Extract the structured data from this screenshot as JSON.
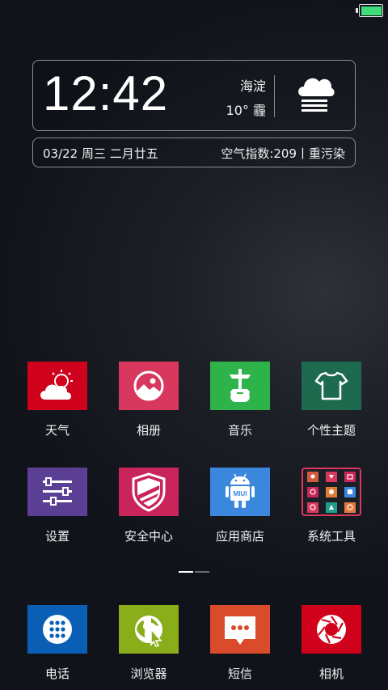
{
  "status": {
    "battery_level": 1.0,
    "battery_color": "#3fdc7a"
  },
  "clock_widget": {
    "time": "12:42",
    "location": "海淀",
    "temperature": "10° 霾",
    "weather_icon": "fog-cloud-icon"
  },
  "info_widget": {
    "date": "03/22 周三 二月廿五",
    "air_quality": "空气指数:209丨重污染"
  },
  "apps": [
    {
      "label": "天气",
      "icon": "weather-icon",
      "color": "#d0021b"
    },
    {
      "label": "相册",
      "icon": "gallery-icon",
      "color": "#d9385e"
    },
    {
      "label": "音乐",
      "icon": "music-icon",
      "color": "#2db34a"
    },
    {
      "label": "个性主题",
      "icon": "theme-icon",
      "color": "#1e6a4f"
    },
    {
      "label": "设置",
      "icon": "settings-icon",
      "color": "#5b3f94"
    },
    {
      "label": "安全中心",
      "icon": "security-icon",
      "color": "#c9255a"
    },
    {
      "label": "应用商店",
      "icon": "app-store-icon",
      "color": "#3a87dd"
    },
    {
      "label": "系统工具",
      "icon": "tools-folder-icon",
      "color": "#1b1e25"
    }
  ],
  "dock": [
    {
      "label": "电话",
      "icon": "phone-icon",
      "color": "#0a5fb4"
    },
    {
      "label": "浏览器",
      "icon": "browser-icon",
      "color": "#8aad1a"
    },
    {
      "label": "短信",
      "icon": "messages-icon",
      "color": "#d94b2b"
    },
    {
      "label": "相机",
      "icon": "camera-icon",
      "color": "#d0021b"
    }
  ],
  "page_indicator": {
    "pages": 2,
    "current": 1
  }
}
